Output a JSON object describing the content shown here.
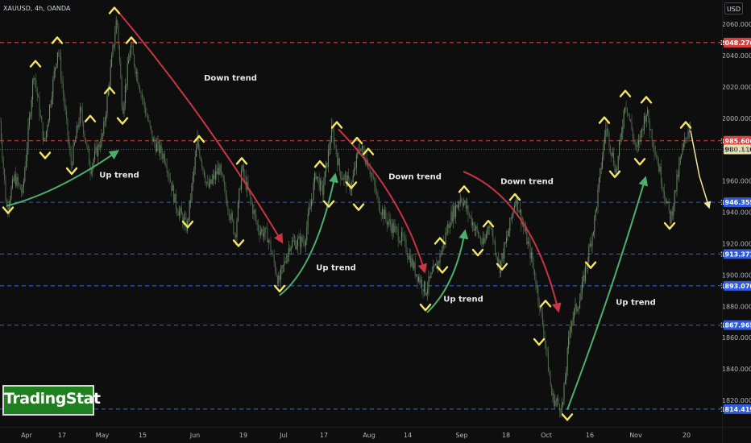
{
  "header": {
    "symbol_line": "XAUUSD, 4h, OANDA"
  },
  "currency_button": "USD",
  "watermark": {
    "text": "TradingStat"
  },
  "colors": {
    "background": "#0e0e0e",
    "candles": "#6f8f6a",
    "support_line": "#2f5bd8",
    "resistance_line": "#d94040",
    "down_arrow": "#c73546",
    "up_arrow": "#4caf6d",
    "marker": "#f5e66a",
    "projection": "#f3e6a0",
    "logo_bg": "#1e7f1e"
  },
  "chart_data": {
    "type": "line",
    "title": "XAUUSD, 4h, OANDA",
    "xlabel": "",
    "ylabel": "",
    "ylim": [
      1806,
      2071
    ],
    "x_ticks": [
      "Apr",
      "17",
      "May",
      "15",
      "Jun",
      "19",
      "Jul",
      "17",
      "Aug",
      "14",
      "Sep",
      "18",
      "Oct",
      "16",
      "Nov",
      "20"
    ],
    "y_ticks": [
      1820,
      1840,
      1860,
      1880,
      1900,
      1920,
      1940,
      1960,
      1980,
      2000,
      2020,
      2040,
      2060
    ],
    "price_levels": [
      {
        "value": 2048.276,
        "label": "2048.276",
        "kind": "resistance"
      },
      {
        "value": 1985.606,
        "label": "1985.606",
        "kind": "resistance"
      },
      {
        "value": 1980.11,
        "label": "1980.110",
        "kind": "last"
      },
      {
        "value": 1946.355,
        "label": "1946.355",
        "kind": "support"
      },
      {
        "value": 1913.371,
        "label": "1913.371",
        "kind": "support"
      },
      {
        "value": 1893.07,
        "label": "1893.070",
        "kind": "support"
      },
      {
        "value": 1867.965,
        "label": "1867.965",
        "kind": "support"
      },
      {
        "value": 1814.419,
        "label": "1814.419",
        "kind": "support"
      }
    ],
    "series": [
      {
        "values": [
          [
            0,
            1998
          ],
          [
            8,
            1942
          ],
          [
            18,
            1962
          ],
          [
            28,
            1952
          ],
          [
            42,
            2030
          ],
          [
            55,
            1983
          ],
          [
            72,
            2046
          ],
          [
            88,
            1970
          ],
          [
            100,
            2005
          ],
          [
            112,
            1968
          ],
          [
            128,
            1990
          ],
          [
            145,
            2065
          ],
          [
            152,
            2005
          ],
          [
            162,
            2046
          ],
          [
            178,
            2010
          ],
          [
            190,
            1985
          ],
          [
            205,
            1975
          ],
          [
            218,
            1945
          ],
          [
            232,
            1930
          ],
          [
            245,
            1985
          ],
          [
            258,
            1955
          ],
          [
            272,
            1968
          ],
          [
            292,
            1925
          ],
          [
            300,
            1968
          ],
          [
            320,
            1930
          ],
          [
            332,
            1925
          ],
          [
            346,
            1895
          ],
          [
            360,
            1920
          ],
          [
            378,
            1922
          ],
          [
            392,
            1965
          ],
          [
            400,
            1952
          ],
          [
            412,
            1993
          ],
          [
            422,
            1965
          ],
          [
            436,
            1956
          ],
          [
            446,
            1983
          ],
          [
            458,
            1970
          ],
          [
            470,
            1945
          ],
          [
            480,
            1935
          ],
          [
            500,
            1922
          ],
          [
            515,
            1903
          ],
          [
            528,
            1890
          ],
          [
            545,
            1910
          ],
          [
            558,
            1935
          ],
          [
            572,
            1950
          ],
          [
            585,
            1935
          ],
          [
            600,
            1918
          ],
          [
            607,
            1935
          ],
          [
            620,
            1905
          ],
          [
            630,
            1925
          ],
          [
            640,
            1950
          ],
          [
            650,
            1930
          ],
          [
            660,
            1910
          ],
          [
            670,
            1880
          ],
          [
            676,
            1860
          ],
          [
            685,
            1822
          ],
          [
            698,
            1815
          ],
          [
            708,
            1870
          ],
          [
            720,
            1885
          ],
          [
            738,
            1935
          ],
          [
            752,
            1995
          ],
          [
            765,
            1965
          ],
          [
            776,
            2012
          ],
          [
            790,
            1978
          ],
          [
            802,
            2005
          ],
          [
            815,
            1975
          ],
          [
            832,
            1935
          ],
          [
            845,
            1975
          ],
          [
            855,
            1995
          ]
        ]
      }
    ],
    "annotations": [
      {
        "text": "Down trend",
        "x": 286,
        "y": 2024,
        "color": "#e6e6e6"
      },
      {
        "text": "Up trend",
        "x": 148,
        "y": 1962,
        "color": "#e6e6e6"
      },
      {
        "text": "Down trend",
        "x": 515,
        "y": 1961,
        "color": "#e6e6e6"
      },
      {
        "text": "Up trend",
        "x": 417,
        "y": 1903,
        "color": "#e6e6e6"
      },
      {
        "text": "Down trend",
        "x": 654,
        "y": 1958,
        "color": "#e6e6e6"
      },
      {
        "text": "Up trend",
        "x": 575,
        "y": 1883,
        "color": "#e6e6e6"
      },
      {
        "text": "Up trend",
        "x": 789,
        "y": 1881,
        "color": "#e6e6e6"
      }
    ],
    "trend_arrows": [
      {
        "kind": "up",
        "path": [
          [
            8,
            1944
          ],
          [
            70,
            1952
          ],
          [
            146,
            1979
          ]
        ]
      },
      {
        "kind": "down",
        "path": [
          [
            145,
            2069
          ],
          [
            258,
            2000
          ],
          [
            350,
            1921
          ]
        ]
      },
      {
        "kind": "up",
        "path": [
          [
            347,
            1887
          ],
          [
            392,
            1905
          ],
          [
            416,
            1964
          ]
        ]
      },
      {
        "kind": "down",
        "path": [
          [
            420,
            1993
          ],
          [
            500,
            1950
          ],
          [
            527,
            1902
          ]
        ]
      },
      {
        "kind": "up",
        "path": [
          [
            530,
            1876
          ],
          [
            565,
            1893
          ],
          [
            577,
            1928
          ]
        ]
      },
      {
        "kind": "down",
        "path": [
          [
            575,
            1966
          ],
          [
            660,
            1948
          ],
          [
            693,
            1877
          ]
        ]
      },
      {
        "kind": "up",
        "path": [
          [
            704,
            1814
          ],
          [
            760,
            1890
          ],
          [
            801,
            1962
          ]
        ]
      }
    ],
    "projection": [
      [
        857,
        1992
      ],
      [
        868,
        1963
      ],
      [
        880,
        1943
      ]
    ],
    "swing_markers": [
      {
        "x": 10,
        "y": 1941,
        "dir": "low"
      },
      {
        "x": 44,
        "y": 2035,
        "dir": "high"
      },
      {
        "x": 56,
        "y": 1976,
        "dir": "low"
      },
      {
        "x": 71,
        "y": 2050,
        "dir": "high"
      },
      {
        "x": 89,
        "y": 1966,
        "dir": "low"
      },
      {
        "x": 112,
        "y": 2000,
        "dir": "high"
      },
      {
        "x": 136,
        "y": 2018,
        "dir": "high"
      },
      {
        "x": 142,
        "y": 2069,
        "dir": "high"
      },
      {
        "x": 152,
        "y": 1998,
        "dir": "low"
      },
      {
        "x": 163,
        "y": 2050,
        "dir": "high"
      },
      {
        "x": 233,
        "y": 1932,
        "dir": "low"
      },
      {
        "x": 247,
        "y": 1987,
        "dir": "high"
      },
      {
        "x": 296,
        "y": 1920,
        "dir": "low"
      },
      {
        "x": 300,
        "y": 1973,
        "dir": "high"
      },
      {
        "x": 347,
        "y": 1891,
        "dir": "low"
      },
      {
        "x": 397,
        "y": 1971,
        "dir": "high"
      },
      {
        "x": 408,
        "y": 1945,
        "dir": "low"
      },
      {
        "x": 418,
        "y": 1996,
        "dir": "high"
      },
      {
        "x": 436,
        "y": 1957,
        "dir": "low"
      },
      {
        "x": 443,
        "y": 1986,
        "dir": "high"
      },
      {
        "x": 445,
        "y": 1943,
        "dir": "low"
      },
      {
        "x": 457,
        "y": 1979,
        "dir": "high"
      },
      {
        "x": 528,
        "y": 1879,
        "dir": "low"
      },
      {
        "x": 546,
        "y": 1922,
        "dir": "high"
      },
      {
        "x": 549,
        "y": 1903,
        "dir": "low"
      },
      {
        "x": 576,
        "y": 1955,
        "dir": "high"
      },
      {
        "x": 593,
        "y": 1914,
        "dir": "low"
      },
      {
        "x": 606,
        "y": 1933,
        "dir": "high"
      },
      {
        "x": 623,
        "y": 1905,
        "dir": "low"
      },
      {
        "x": 639,
        "y": 1950,
        "dir": "high"
      },
      {
        "x": 677,
        "y": 1882,
        "dir": "high"
      },
      {
        "x": 669,
        "y": 1857,
        "dir": "low"
      },
      {
        "x": 704,
        "y": 1809,
        "dir": "low"
      },
      {
        "x": 733,
        "y": 1906,
        "dir": "low"
      },
      {
        "x": 750,
        "y": 1999,
        "dir": "high"
      },
      {
        "x": 763,
        "y": 1964,
        "dir": "low"
      },
      {
        "x": 776,
        "y": 2016,
        "dir": "high"
      },
      {
        "x": 794,
        "y": 1972,
        "dir": "low"
      },
      {
        "x": 802,
        "y": 2012,
        "dir": "high"
      },
      {
        "x": 831,
        "y": 1931,
        "dir": "low"
      },
      {
        "x": 851,
        "y": 1996,
        "dir": "high"
      }
    ],
    "grid": false,
    "legend": "none"
  }
}
